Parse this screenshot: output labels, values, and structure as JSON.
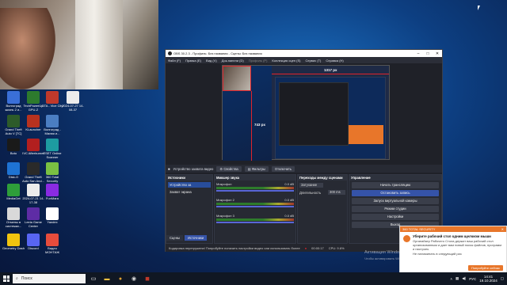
{
  "desktop_icons": [
    {
      "label": "Волгоград жизнь 2 и...",
      "color": "#3a6fd8"
    },
    {
      "label": "TechPowerUp GPU-Z",
      "color": "#2d7a2d"
    },
    {
      "label": "GTA - Vice City",
      "color": "#c0392b"
    },
    {
      "label": "2024-07-27 14-08-37",
      "color": "#ececec"
    },
    {
      "label": "Grand Theft Auto V [TC]",
      "color": "#2d5b2a"
    },
    {
      "label": "KLauncher",
      "color": "#b8321f"
    },
    {
      "label": "Волгоград - Малая и...",
      "color": "#4b7ec2"
    },
    {
      "label": "Boto",
      "color": "#1a1a1a"
    },
    {
      "label": "IVC Afterburner",
      "color": "#b21f1f"
    },
    {
      "label": "ESET Online Scanner",
      "color": "#1d9ca1"
    },
    {
      "label": "Disk-O",
      "color": "#1e73d3"
    },
    {
      "label": "Grand Theft Auto San And...",
      "color": "#2a2a2a"
    },
    {
      "label": "360 Total Security",
      "color": "#7ac143"
    },
    {
      "label": "MediaGet",
      "color": "#2e9e3a"
    },
    {
      "label": "2024-07-21 14-17-38",
      "color": "#ececec"
    },
    {
      "label": "FunMara",
      "color": "#8a2be2"
    },
    {
      "label": "Отмены в системах...",
      "color": "#d9d9d9"
    },
    {
      "label": "Leela Game Center",
      "color": "#5e2ca5"
    },
    {
      "label": "Yandex",
      "color": "#ffffff"
    },
    {
      "label": "Geometry Dash",
      "color": "#f1c40f"
    },
    {
      "label": "Discord",
      "color": "#5865f2"
    },
    {
      "label": "Видео МОНТАЖ",
      "color": "#e74c3c"
    }
  ],
  "obs": {
    "title": "OBS 30.2.3 - Профиль: Без названия - Сцены: Без названия",
    "menu": [
      "Файл (F)",
      "Правка (E)",
      "Вид (V)",
      "Док-панели (D)",
      "Профиль (P)",
      "Коллекция сцен (S)",
      "Сервис (T)",
      "Справка (H)"
    ],
    "measure_h": "1317 px",
    "measure_v": "743 px",
    "source_toolbar": {
      "source_name": "Устройство захвата видео",
      "properties": "Свойства",
      "filters": "Фильтры",
      "deactivate": "Отключить"
    },
    "scenes": {
      "header": "Источники",
      "items": [
        "Устройство за",
        "Захват экрана"
      ],
      "tab_scenes": "Сцены",
      "tab_sources": "Источники"
    },
    "mixer": {
      "header": "Микшер звука",
      "channels": [
        {
          "name": "Микрофон",
          "db": "0.0 dB"
        },
        {
          "name": "Микрофон 2",
          "db": "0.0 dB"
        },
        {
          "name": "Микрофон 3",
          "db": "0.0 dB"
        }
      ]
    },
    "transitions": {
      "header": "Переходы между сценами",
      "type_label": "Затухание",
      "duration_label": "Длительность",
      "duration_value": "300 ms"
    },
    "controls": {
      "header": "Управление",
      "buttons": [
        "Начать трансляцию",
        "Остановить запись",
        "Запуск виртуальной камеры",
        "Режим студии",
        "Настройки",
        "Выход"
      ]
    },
    "status": {
      "message": "Кодировка перегружена! Попробуйте понизить настройки видео или использовать более",
      "rec_time": "00:00:17",
      "cpu": "CPU: 9.6%",
      "fps": "60.00 / 60.00 FPS"
    }
  },
  "notification": {
    "app": "360 TOTAL SECURITY",
    "title": "Уберите рабочий стол одним щелчком мыши",
    "body": "Органайзер Рабочего Стола держит ваш рабочий стол организованным и дает вам новый поиск файлов, программ и настроек.",
    "remind": "Не напоминать в следующий раз",
    "button": "Попробуйте сейчас"
  },
  "watermark": {
    "title": "Активация Windows",
    "sub": "Чтобы активировать Windows, перейдите в раздел \"Параметры\"."
  },
  "taskbar": {
    "search_placeholder": "Поиск",
    "lang": "РУС",
    "time": "14:41",
    "date": "19.10.2024"
  }
}
